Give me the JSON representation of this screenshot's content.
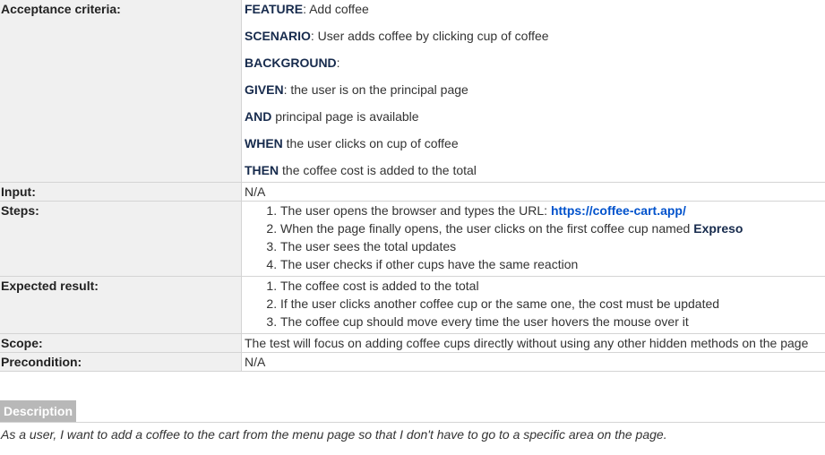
{
  "rows": {
    "acceptance": {
      "label": "Acceptance criteria:",
      "feature_kw": "FEATURE",
      "feature_text": ": Add coffee",
      "scenario_kw": "SCENARIO",
      "scenario_text": ": User adds coffee by clicking cup of coffee",
      "background_kw": "BACKGROUND",
      "background_text": ":",
      "given_kw": "GIVEN",
      "given_text": ": the user is on the principal page",
      "and_kw": "AND",
      "and_text": " principal page is available",
      "when_kw": "WHEN",
      "when_text": " the user clicks on cup of coffee",
      "then_kw": "THEN",
      "then_text": " the coffee cost is added to the total"
    },
    "input": {
      "label": "Input:",
      "value": "N/A"
    },
    "steps": {
      "label": "Steps:",
      "items": [
        {
          "text": "The user opens the browser and types the URL: ",
          "link": "https://coffee-cart.app/"
        },
        {
          "text": "When the page finally opens, the user clicks on the first coffee cup named ",
          "bold": "Expreso"
        },
        {
          "text": "The user sees the total updates"
        },
        {
          "text": "The user checks if other cups have the same reaction"
        }
      ]
    },
    "expected": {
      "label": "Expected result:",
      "items": [
        "The coffee cost is added to the total",
        "If the user clicks another coffee cup or the same one, the cost must be updated",
        "The coffee cup should move every time the user hovers the mouse over it"
      ]
    },
    "scope": {
      "label": "Scope:",
      "value": "The test will focus on adding coffee cups directly without using any other hidden methods on the page"
    },
    "precondition": {
      "label": "Precondition:",
      "value": "N/A"
    }
  },
  "description": {
    "tab_label": "Description",
    "text": "As a user, I want to add a coffee to the cart from the menu page so that I don't have to go to a specific area on the page."
  }
}
